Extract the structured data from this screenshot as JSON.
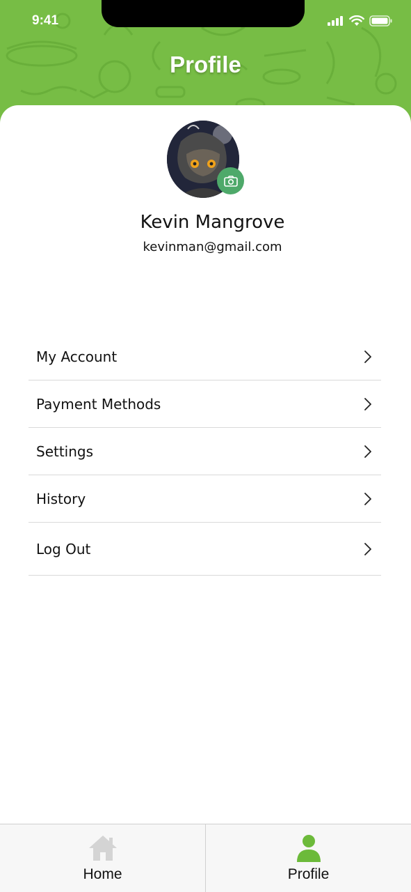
{
  "status_bar": {
    "time": "9:41"
  },
  "header": {
    "title": "Profile"
  },
  "profile": {
    "name": "Kevin Mangrove",
    "email": "kevinman@gmail.com"
  },
  "menu": {
    "items": [
      {
        "label": "My Account",
        "icon": "chevron-right-icon"
      },
      {
        "label": "Payment Methods",
        "icon": "chevron-right-icon"
      },
      {
        "label": "Settings",
        "icon": "chevron-right-icon"
      },
      {
        "label": "History",
        "icon": "chevron-right-icon"
      },
      {
        "label": "Log Out",
        "icon": "chevron-right-icon"
      }
    ]
  },
  "bottom_nav": {
    "tabs": [
      {
        "label": "Home",
        "icon": "home-icon",
        "active": false
      },
      {
        "label": "Profile",
        "icon": "user-icon",
        "active": true
      }
    ]
  },
  "colors": {
    "header_green": "#77bd45",
    "camera_button": "#4ea96a",
    "active_tab_icon": "#6cba3a",
    "inactive_tab_icon": "#d4d4d4"
  }
}
